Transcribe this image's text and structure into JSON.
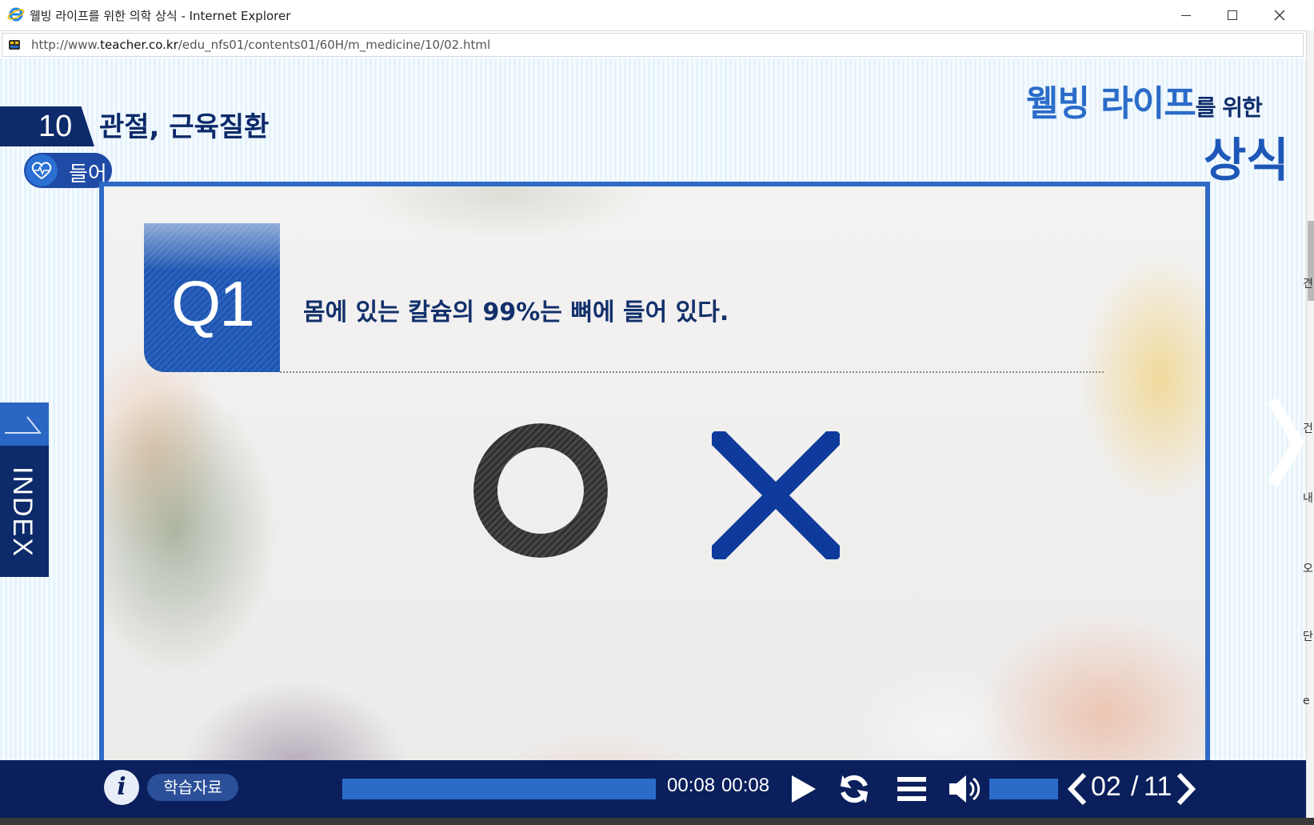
{
  "window": {
    "title": "웰빙 라이프를 위한 의학 상식 - Internet Explorer",
    "url_prefix": "http://www.",
    "url_domain": "teacher.co.kr",
    "url_path": "/edu_nfs01/contents01/60H/m_medicine/10/02.html"
  },
  "header": {
    "lesson_number": "10",
    "lesson_title": "관절, 근육질환",
    "subsection": "들어",
    "brand_main": "웰빙 라이프",
    "brand_suffix": "를 위한",
    "brand_line2": "상식"
  },
  "sidebar": {
    "index_label": "INDEX"
  },
  "quiz": {
    "badge": "Q1",
    "question": "몸에 있는 칼슘의 99%는 뼈에 들어 있다.",
    "options": [
      "O",
      "X"
    ],
    "o_color": "#3a3a3a",
    "x_color": "#0e3a9c"
  },
  "behind_chars": [
    "견",
    "건",
    "내",
    "오",
    "단",
    "e"
  ],
  "player": {
    "material_label": "학습자료",
    "current_time": "00:08",
    "total_time": "00:08",
    "progress": 1.0,
    "volume": 1.0,
    "current_page": "02",
    "page_separator": "/",
    "total_pages": "11"
  },
  "colors": {
    "accent": "#2f6ac5",
    "navy": "#0a1f5c",
    "brand_blue": "#2b6cc9"
  }
}
